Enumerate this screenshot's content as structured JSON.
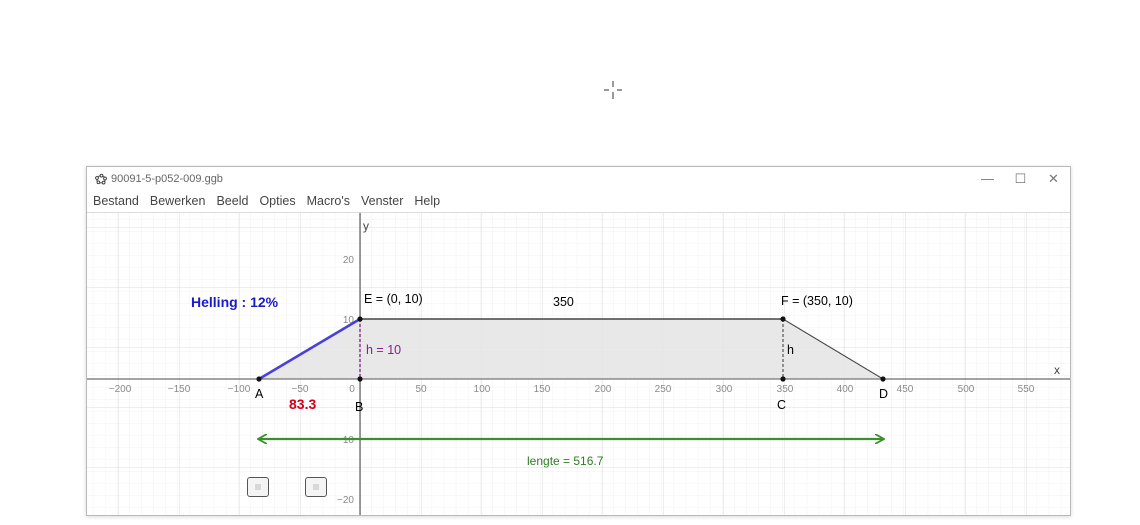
{
  "window": {
    "title": "90091-5-p052-009.ggb",
    "controls": {
      "minimize": "—",
      "maximize": "☐",
      "close": "✕"
    }
  },
  "menu": [
    "Bestand",
    "Bewerken",
    "Beeld",
    "Opties",
    "Macro's",
    "Venster",
    "Help"
  ],
  "axes": {
    "x_label": "x",
    "y_label": "y",
    "x_ticks": [
      "−200",
      "−150",
      "−100",
      "−50",
      "0",
      "50",
      "100",
      "150",
      "200",
      "250",
      "300",
      "350",
      "400",
      "450",
      "500",
      "550"
    ],
    "y_ticks": [
      "20",
      "10",
      "−10",
      "−20"
    ]
  },
  "labels": {
    "helling": "Helling : 12%",
    "e_point": "E = (0, 10)",
    "f_point": "F = (350, 10)",
    "top_length": "350",
    "h_value": "h = 10",
    "h_right": "h",
    "a": "A",
    "b": "B",
    "c": "C",
    "d": "D",
    "ab_length": "83.3",
    "lengte": "lengte = 516.7"
  },
  "colors": {
    "slope_line": "#4a3fd8",
    "helling_text": "#1a1acc",
    "ab_text": "#d0001a",
    "lengte": "#3a8f2f",
    "h_segment": "#8b1a8b",
    "polygon_fill": "#e4e4e4"
  }
}
